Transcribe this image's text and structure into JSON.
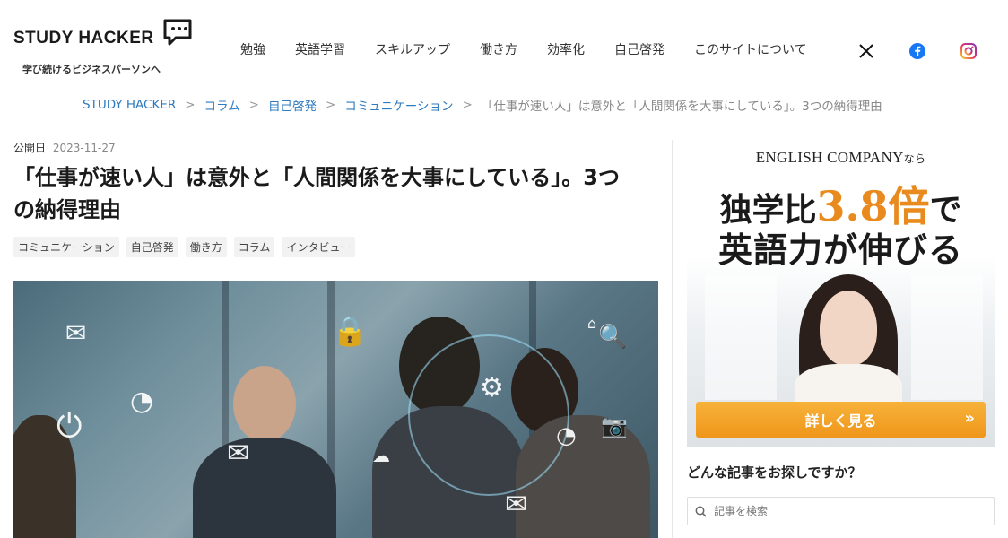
{
  "header": {
    "logo": "STUDY HACKER",
    "tagline": "学び続けるビジネスパーソンへ",
    "nav": [
      "勉強",
      "英語学習",
      "スキルアップ",
      "働き方",
      "効率化",
      "自己啓発",
      "このサイトについて"
    ],
    "social": [
      {
        "name": "x-icon",
        "glyph": "𝕏",
        "color": "#000000"
      },
      {
        "name": "facebook-icon",
        "glyph": "f",
        "color": "#1877f2"
      },
      {
        "name": "instagram-icon",
        "glyph": "◎",
        "color": "#d6249f"
      }
    ]
  },
  "breadcrumb": {
    "items": [
      "STUDY HACKER",
      "コラム",
      "自己啓発",
      "コミュニケーション"
    ],
    "separator": ">",
    "current": "「仕事が速い人」は意外と「人間関係を大事にしている」。3つの納得理由"
  },
  "article": {
    "published_label": "公開日",
    "published_date": "2023-11-27",
    "title": "「仕事が速い人」は意外と「人間関係を大事にしている」。3つの納得理由",
    "tags": [
      "コミュニケーション",
      "自己啓発",
      "働き方",
      "コラム",
      "インタビュー"
    ],
    "hero_icons": [
      "✉",
      "🔒",
      "⏻",
      "◔",
      "⚙",
      "✉",
      "🔍",
      "📷",
      "◔",
      "✉",
      "⌂",
      "☁"
    ]
  },
  "sidebar": {
    "ad": {
      "brand": "ENGLISH COMPANY",
      "brand_suffix": "なら",
      "line1_pre": "独学比",
      "line1_accent": "3.8倍",
      "line1_post": "で",
      "line2": "英語力が伸びる",
      "button_label": "詳しく見る",
      "button_chevron": "»"
    },
    "search": {
      "heading": "どんな記事をお探しですか？",
      "placeholder": "記事を検索"
    }
  },
  "colors": {
    "link": "#2f7bbf",
    "accent": "#e98a1e",
    "button": "#ef961a"
  }
}
